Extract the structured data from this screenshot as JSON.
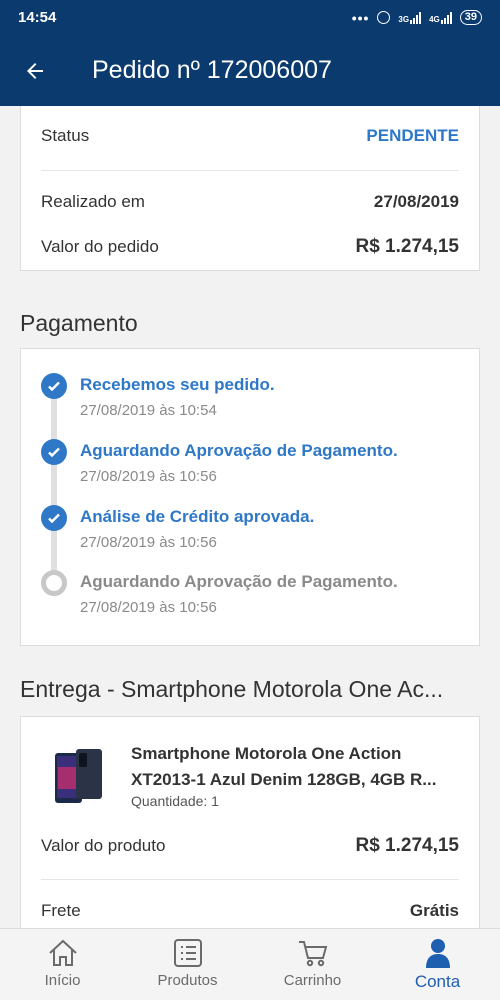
{
  "status_bar": {
    "time": "14:54",
    "signal_1_label": "3G",
    "signal_2_label": "4G",
    "battery": "39"
  },
  "app_bar": {
    "title": "Pedido nº 172006007",
    "back_icon": "arrow-left-icon"
  },
  "order_summary": {
    "status_label": "Status",
    "status_value": "PENDENTE",
    "date_label": "Realizado em",
    "date_value": "27/08/2019",
    "total_label": "Valor do pedido",
    "total_value": "R$ 1.274,15",
    "status_color": "#2e78c7"
  },
  "payment": {
    "section_title": "Pagamento",
    "steps": [
      {
        "title": "Recebemos seu pedido.",
        "date": "27/08/2019 às 10:54",
        "state": "done"
      },
      {
        "title": "Aguardando Aprovação de Pagamento.",
        "date": "27/08/2019 às 10:56",
        "state": "done"
      },
      {
        "title": "Análise de Crédito aprovada.",
        "date": "27/08/2019 às 10:56",
        "state": "done"
      },
      {
        "title": "Aguardando Aprovação de Pagamento.",
        "date": "27/08/2019 às 10:56",
        "state": "pending"
      }
    ]
  },
  "delivery": {
    "section_title": "Entrega - Smartphone Motorola One Ac...",
    "product": {
      "name_line_1": "Smartphone Motorola One Action",
      "name_line_2": "XT2013-1 Azul Denim 128GB, 4GB R...",
      "quantity": "Quantidade: 1"
    },
    "product_value_label": "Valor do produto",
    "product_value": "R$ 1.274,15",
    "shipping_label": "Frete",
    "shipping_value": "Grátis"
  },
  "bottom_nav": {
    "items": [
      {
        "label": "Início",
        "icon": "home-icon"
      },
      {
        "label": "Produtos",
        "icon": "list-icon"
      },
      {
        "label": "Carrinho",
        "icon": "cart-icon"
      },
      {
        "label": "Conta",
        "icon": "user-icon",
        "active": true
      }
    ],
    "active_color": "#1f5fb0"
  },
  "colors": {
    "header": "#0b3a6f",
    "accent": "#2e78c7"
  }
}
